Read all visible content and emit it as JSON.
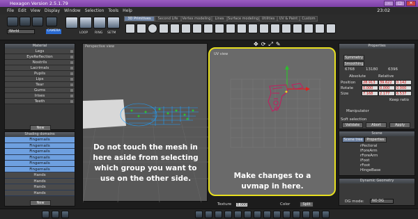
{
  "window": {
    "title": "Hexagon Version 2.5.1.79",
    "clock": "23:02"
  },
  "menu": [
    "File",
    "Edit",
    "View",
    "Display",
    "Window",
    "Selection",
    "Tools",
    "Help"
  ],
  "toolbar": {
    "world_select": "World",
    "tool_labels": [
      "LOOP",
      "RING",
      "SETM",
      "CAMERA"
    ],
    "tabs": [
      "3D Primitives",
      "Second Life",
      "Vertex modeling",
      "Lines",
      "Surface modeling",
      "Utilities",
      "UV & Paint",
      "Custom"
    ],
    "active_tab": "3D Primitives"
  },
  "material": {
    "title": "Material",
    "items": [
      "Legs",
      "EyeReflection",
      "Nostrils",
      "Lacrimals",
      "Pupils",
      "Lips",
      "Tear",
      "Gums",
      "Irises",
      "Teeth"
    ],
    "new_label": "New"
  },
  "shading": {
    "title": "Shading domains",
    "items": [
      "Fingernails",
      "Fingernails",
      "Fingernails",
      "Fingernails",
      "Fingernails",
      "Fingernails",
      "Hands",
      "Hands",
      "Hands",
      "Hands"
    ],
    "new_label": "New"
  },
  "viewport": {
    "label": "Perspective view"
  },
  "uvview": {
    "label": "UV view"
  },
  "notes": {
    "left": "Do not touch the mesh in here aside from selecting which group you want to use on the other side.",
    "right": "Make changes to a uvmap in here."
  },
  "properties": {
    "title": "Properties",
    "tab1": "Symmetry",
    "tab2": "Smoothing",
    "counts": [
      "6768",
      "13180",
      "6396"
    ],
    "absolute": "Absolute",
    "relative": "Relative",
    "rows": [
      {
        "label": "Position",
        "x": "28.913",
        "y": "39.622",
        "z": "0.142"
      },
      {
        "label": "Rotate",
        "x": "0.000",
        "y": "0.000",
        "z": "0.000"
      },
      {
        "label": "Size",
        "x": "7.168",
        "y": "2.177",
        "z": "6.537"
      }
    ],
    "keep_ratio": "Keep ratio",
    "manipulator": "Manipulator",
    "soft_selection": "Soft selection",
    "validate": "Validate",
    "abort": "Abort",
    "apply": "Apply"
  },
  "scene": {
    "title": "Scene",
    "tab1": "Scene tree",
    "tab2": "Properties",
    "items": [
      "rPectoral",
      "lForeArm",
      "rForeArm",
      "lFoot",
      "rFoot",
      "HingeBase"
    ]
  },
  "dynamic": {
    "title": "Dynamic Geometry",
    "dg_mode": "DG mode:",
    "dg_value": "NO DG"
  },
  "bottom": {
    "texture": "Texture",
    "texture_value": "0.000",
    "color": "Color",
    "split": "Split"
  }
}
